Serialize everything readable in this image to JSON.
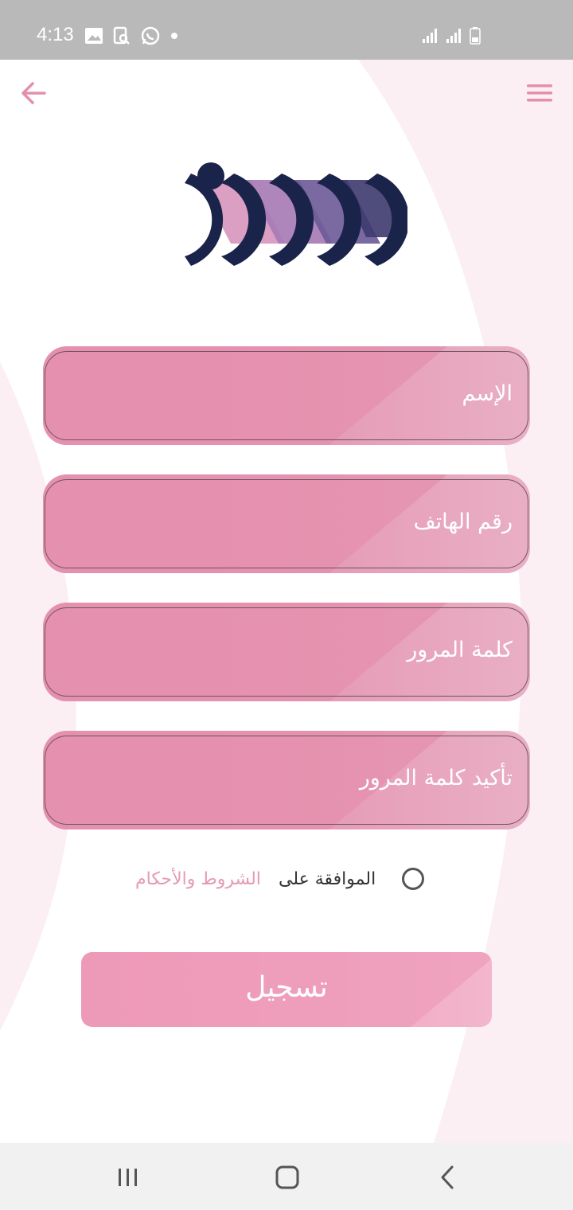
{
  "status_bar": {
    "time": "4:13",
    "left_icons": [
      "image-icon",
      "search-doc-icon",
      "whatsapp-icon",
      "dot-icon"
    ],
    "right_icons": [
      "signal-icon",
      "signal-icon",
      "battery-icon"
    ]
  },
  "top_nav": {
    "back_icon": "arrow-left-icon",
    "menu_icon": "hamburger-menu-icon"
  },
  "colors": {
    "accent": "#e48fad",
    "accent_light": "#e9afc4",
    "logo_navy": "#1a2349",
    "link": "#e49ab6",
    "background_tint": "#fbeff3"
  },
  "form": {
    "fields": [
      {
        "placeholder": "الإسم"
      },
      {
        "placeholder": "رقم الهاتف"
      },
      {
        "placeholder": "كلمة المرور"
      },
      {
        "placeholder": "تأكيد كلمة المرور"
      }
    ]
  },
  "terms": {
    "agree_text": "الموافقة على",
    "link_text": "الشروط والأحكام"
  },
  "register_button": {
    "label": "تسجيل"
  },
  "system_nav": {
    "buttons": [
      "recent-apps-icon",
      "home-icon",
      "back-icon"
    ]
  }
}
